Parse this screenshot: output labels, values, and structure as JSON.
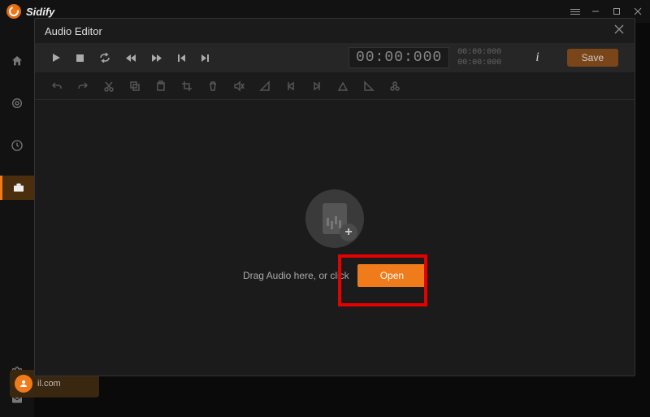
{
  "brand": "Sidify",
  "modal": {
    "title": "Audio Editor",
    "timecode_main": "00:00:000",
    "timecode_a": "00:00:000",
    "timecode_b": "00:00:000",
    "save_label": "Save",
    "drop_text": "Drag Audio here, or click",
    "open_label": "Open"
  },
  "user": {
    "label": "il.com"
  },
  "icons": {
    "play": "play",
    "stop": "stop",
    "loop": "loop",
    "rewind": "rewind",
    "forward": "forward",
    "prev": "prev",
    "next": "next",
    "undo": "undo",
    "redo": "redo",
    "cut": "cut",
    "copy": "copy",
    "paste": "paste",
    "crop": "crop",
    "delete": "delete",
    "mute": "mute",
    "fadein": "fadein",
    "mark_start": "mark_start",
    "mark_end": "mark_end",
    "pitch": "pitch",
    "fadeout": "fadeout",
    "effects": "effects"
  }
}
